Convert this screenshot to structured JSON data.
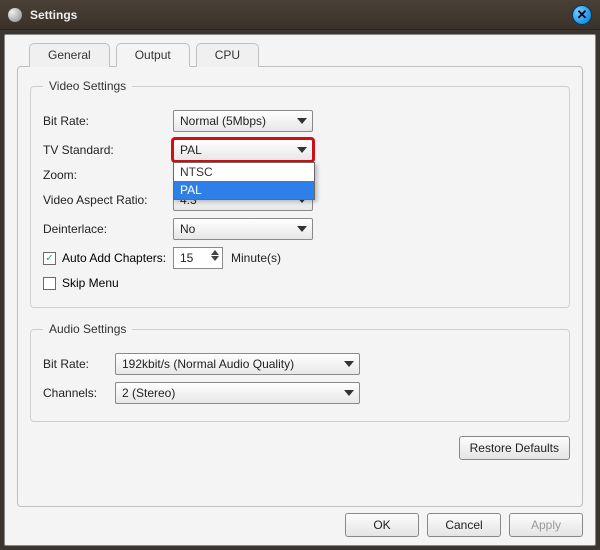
{
  "window": {
    "title": "Settings"
  },
  "tabs": {
    "general": "General",
    "output": "Output",
    "cpu": "CPU",
    "active": "output"
  },
  "video": {
    "legend": "Video Settings",
    "bitrate_label": "Bit Rate:",
    "bitrate_value": "Normal (5Mbps)",
    "tvstd_label": "TV Standard:",
    "tvstd_value": "PAL",
    "tvstd_options": {
      "opt0": "NTSC",
      "opt1": "PAL"
    },
    "zoom_label": "Zoom:",
    "aspect_label": "Video Aspect Ratio:",
    "aspect_value": "4:3",
    "deint_label": "Deinterlace:",
    "deint_value": "No",
    "autoadd_label": "Auto Add Chapters:",
    "autoadd_value": "15",
    "autoadd_unit": "Minute(s)",
    "skipmenu_label": "Skip Menu"
  },
  "audio": {
    "legend": "Audio Settings",
    "bitrate_label": "Bit Rate:",
    "bitrate_value": "192kbit/s (Normal Audio Quality)",
    "channels_label": "Channels:",
    "channels_value": "2 (Stereo)"
  },
  "buttons": {
    "restore": "Restore Defaults",
    "ok": "OK",
    "cancel": "Cancel",
    "apply": "Apply"
  }
}
